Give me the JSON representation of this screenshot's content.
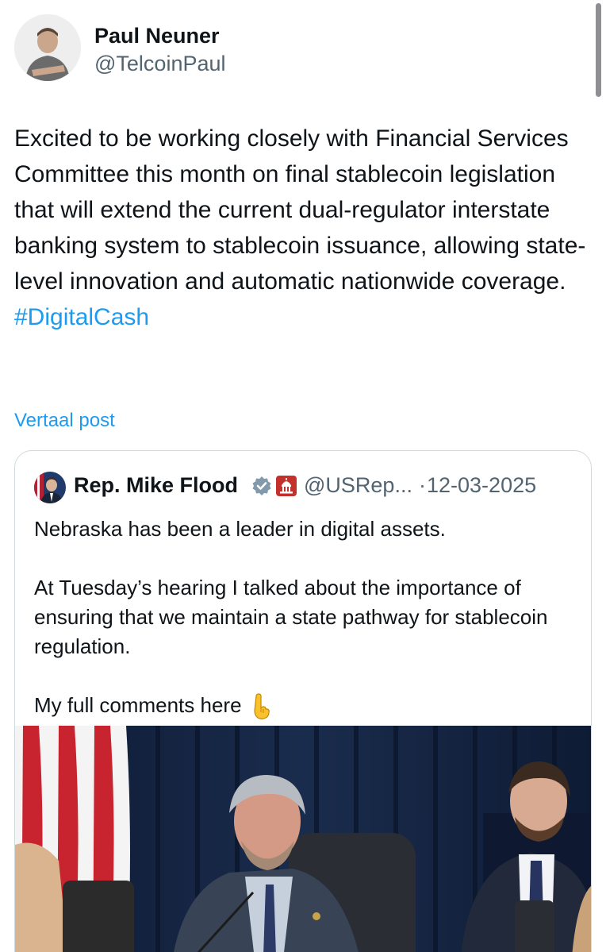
{
  "tweet": {
    "author": {
      "name": "Paul Neuner",
      "handle": "@TelcoinPaul"
    },
    "text": "Excited to be working closely with Financial Services Committee this month on final stablecoin legislation that will extend the current dual-regulator interstate banking system to stablecoin issuance, allowing state-level innovation and automatic nationwide coverage.",
    "hashtag": "#DigitalCash",
    "translate_label": "Vertaal post"
  },
  "quote": {
    "author": {
      "name": "Rep. Mike Flood",
      "handle": "@USRep...",
      "separator": "·",
      "date": "12-03-2025"
    },
    "paragraphs": [
      "Nebraska has been a leader in digital assets.",
      "At Tuesday’s hearing I talked about the importance of ensuring that we maintain a state pathway for stablecoin regulation.",
      "My full comments here"
    ],
    "icons": [
      "verified-badge-icon",
      "government-capitol-icon",
      "backhand-index-pointing-down-icon"
    ]
  },
  "colors": {
    "link": "#1d9bf0",
    "secondary_text": "#536471",
    "card_border": "#cfd9de"
  }
}
